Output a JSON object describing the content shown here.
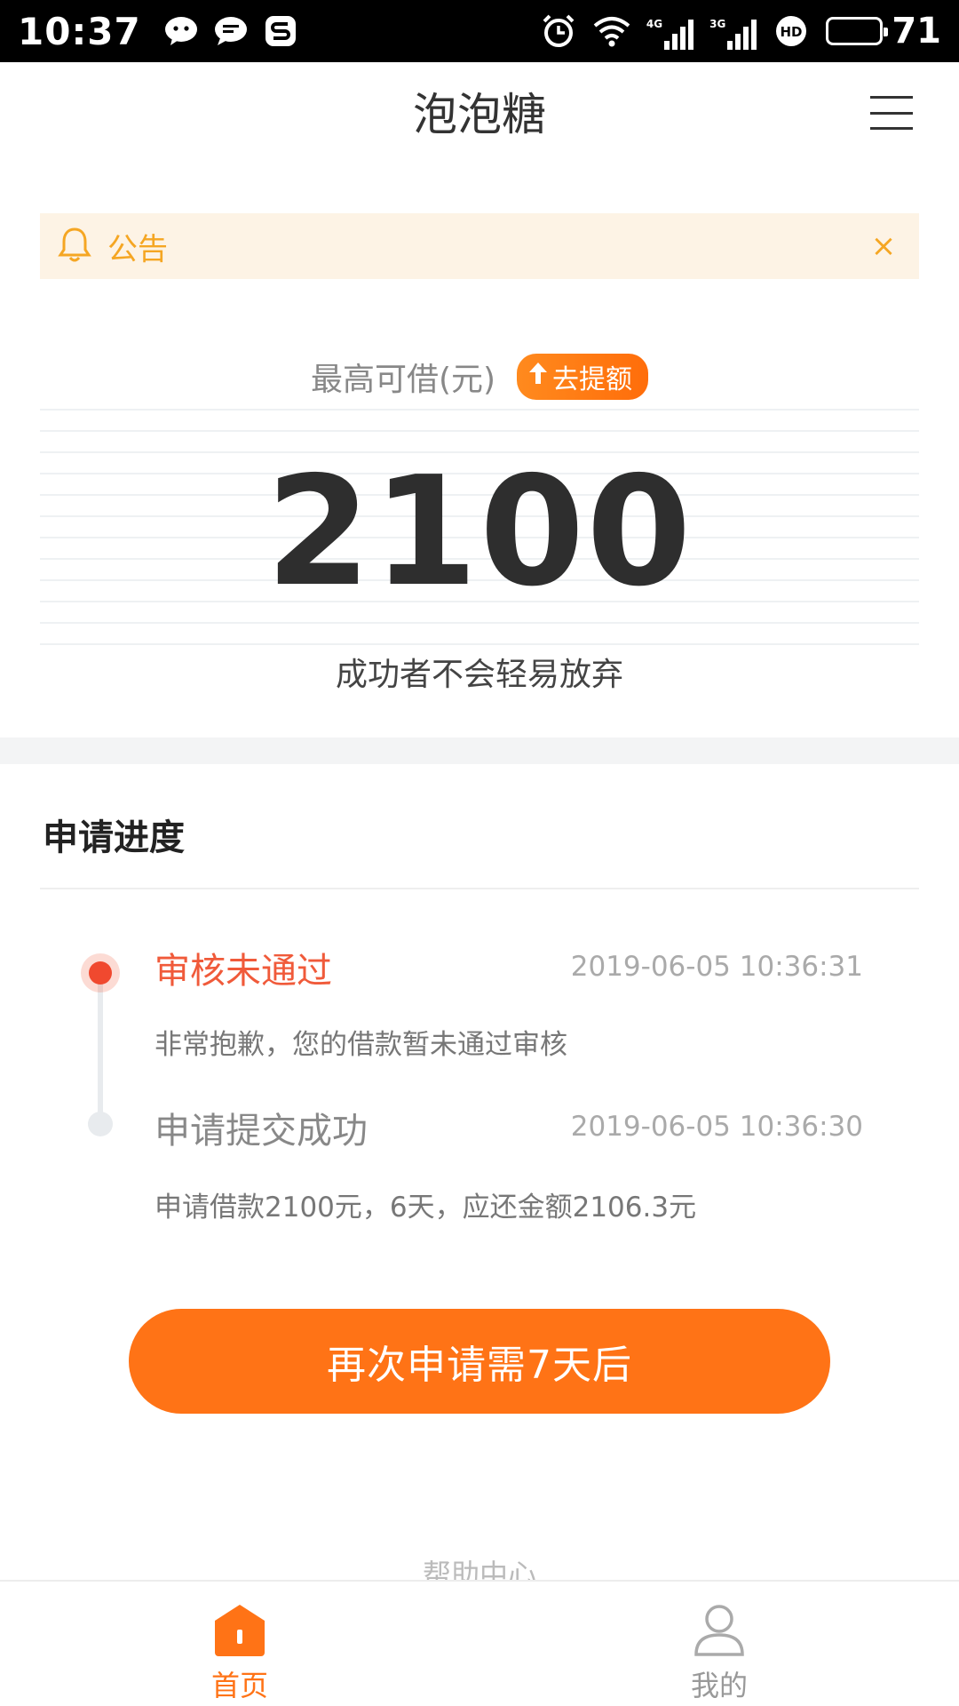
{
  "status_bar": {
    "time": "10:37",
    "left_icons": [
      "wechat-icon",
      "message-icon",
      "s-app-icon"
    ],
    "network_1": "4G",
    "network_2": "3G",
    "hd": "HD",
    "battery": "71"
  },
  "header": {
    "title": "泡泡糖",
    "menu_icon": "hamburger-menu-icon"
  },
  "notice": {
    "icon": "bell-icon",
    "text": "公告",
    "close": "×"
  },
  "credit": {
    "label": "最高可借(元)",
    "raise_label": "去提额",
    "amount": "2100",
    "slogan": "成功者不会轻易放弃"
  },
  "progress": {
    "title": "申请进度",
    "steps": [
      {
        "title": "审核未通过",
        "time": "2019-06-05 10:36:31",
        "desc": "非常抱歉，您的借款暂未通过审核"
      },
      {
        "title": "申请提交成功",
        "time": "2019-06-05 10:36:30",
        "desc": "申请借款2100元，6天，应还金额2106.3元"
      }
    ]
  },
  "action": {
    "label": "再次申请需7天后"
  },
  "help": {
    "label": "帮助中心"
  },
  "nav": {
    "home": "首页",
    "me": "我的"
  },
  "colors": {
    "accent": "#ff7316",
    "reject": "#f05a3a",
    "notice_bg": "#fdf3e5",
    "notice_text": "#f5a623"
  }
}
